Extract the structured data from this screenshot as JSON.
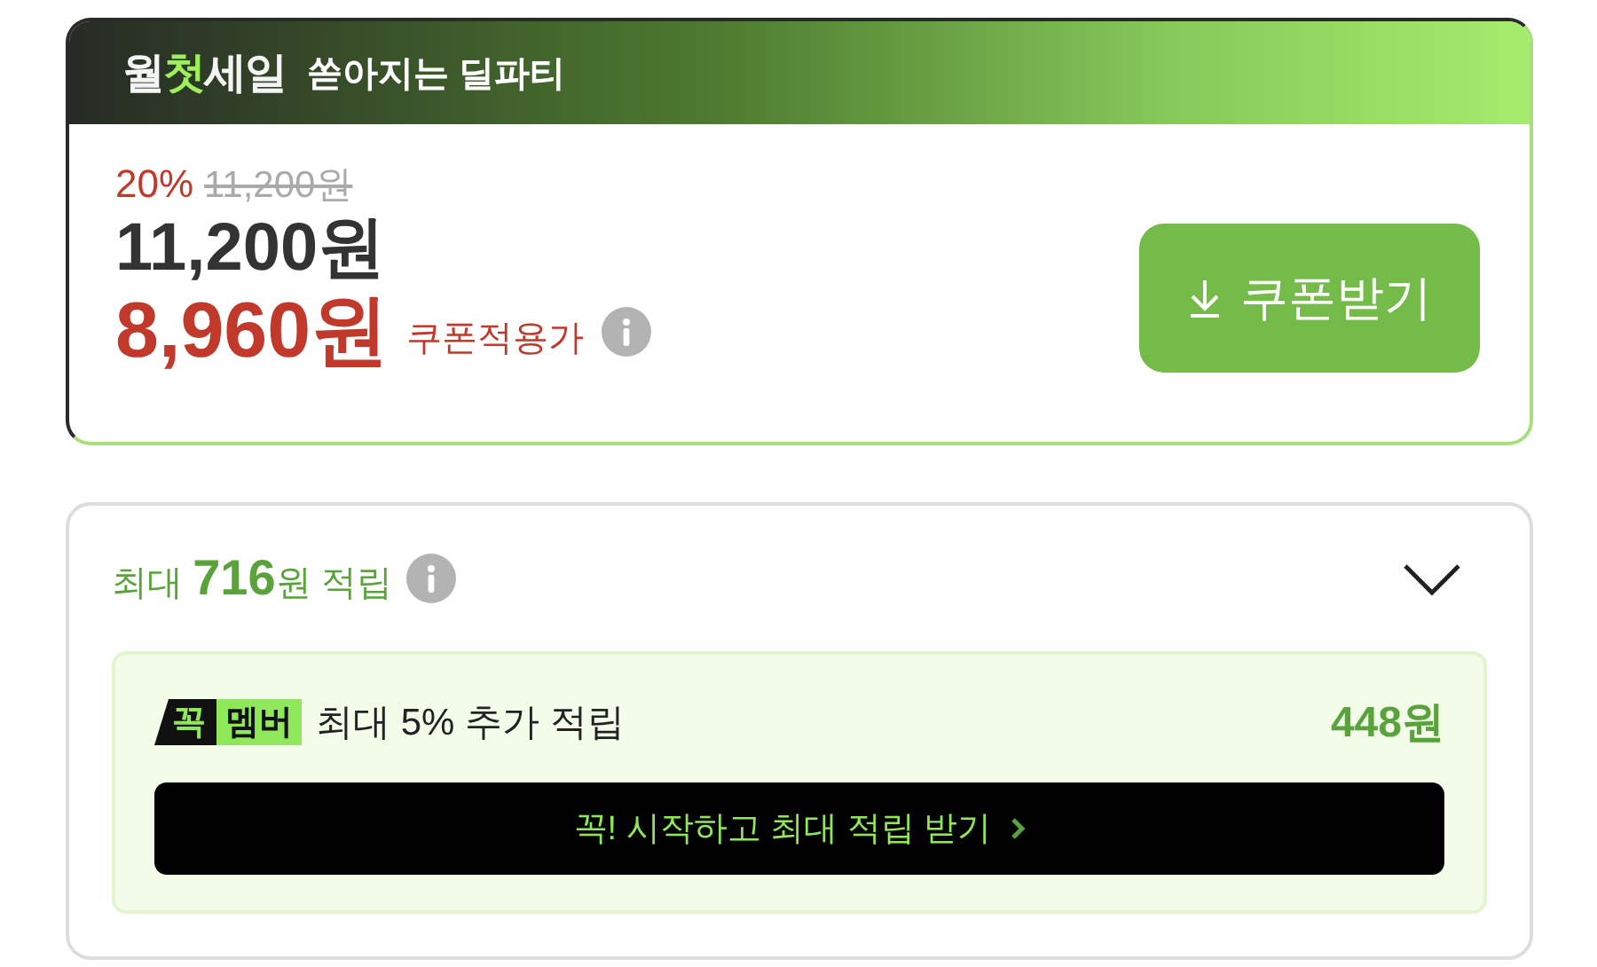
{
  "deal": {
    "banner": {
      "sale_name": [
        {
          "text": "월",
          "highlight": false
        },
        {
          "text": "첫",
          "highlight": true
        },
        {
          "text": "세일",
          "highlight": false
        }
      ],
      "tagline": "쏟아지는 딜파티"
    },
    "discount_rate": "20%",
    "original_price": "11,200원",
    "price": "11,200원",
    "coupon_price": "8,960원",
    "coupon_label": "쿠폰적용가",
    "coupon_button": "쿠폰받기"
  },
  "reward": {
    "title": "최대 **716**원 적립",
    "expanded": true,
    "member": {
      "badge_mark": "꼭",
      "badge_label": "멤버",
      "text": "최대 5% 추가 적립",
      "amount": "448원",
      "cta": "꼭! 시작하고 최대 적립 받기"
    }
  }
}
